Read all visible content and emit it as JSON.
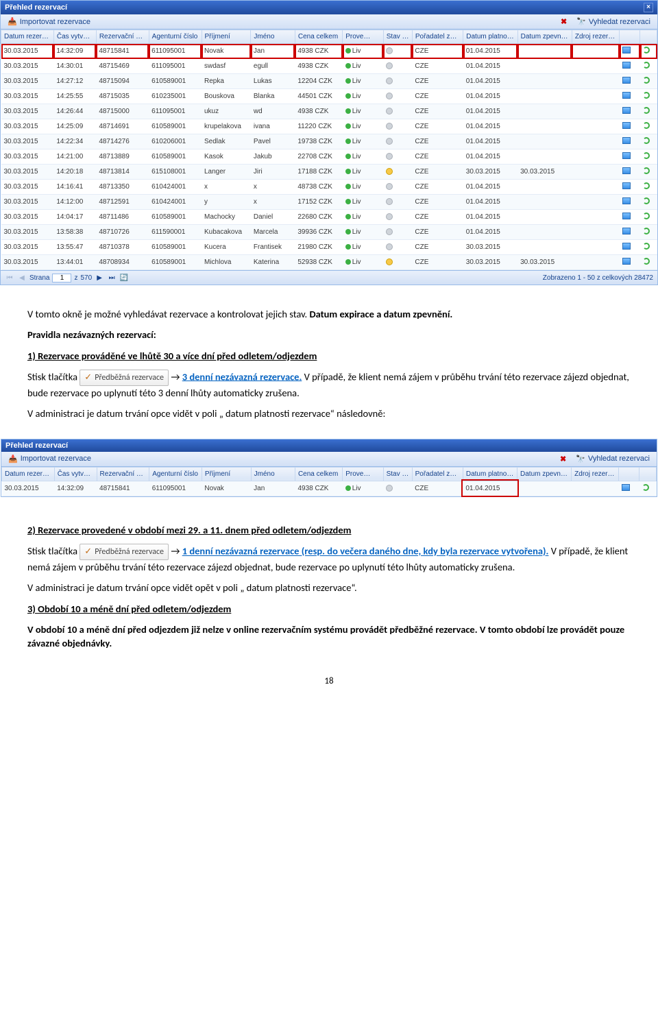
{
  "panel1": {
    "title": "Přehled rezervací",
    "toolbar": {
      "import": "Importovat rezervace",
      "search": "Vyhledat rezervaci"
    },
    "headers": [
      "Datum rezervace",
      "Čas vytvoření",
      "Rezervační číslo",
      "Agenturní číslo",
      "Příjmení",
      "Jméno",
      "Cena celkem",
      "Prove…",
      "Stav r…",
      "Pořadatel zájez…",
      "Datum platnosti…",
      "Datum zpevněn…",
      "Zdroj rezervace"
    ],
    "rows": [
      {
        "d": "30.03.2015",
        "t": "14:32:09",
        "r": "48715841",
        "a": "611095001",
        "s": "Novak",
        "f": "Jan",
        "c": "4938 CZK",
        "liv": "Liv",
        "stav": "grey",
        "cz": "CZE",
        "p": "01.04.2015",
        "z": "",
        "sel": true
      },
      {
        "d": "30.03.2015",
        "t": "14:30:01",
        "r": "48715469",
        "a": "611095001",
        "s": "swdasf",
        "f": "egull",
        "c": "4938 CZK",
        "liv": "Liv",
        "stav": "grey",
        "cz": "CZE",
        "p": "01.04.2015",
        "z": ""
      },
      {
        "d": "30.03.2015",
        "t": "14:27:12",
        "r": "48715094",
        "a": "610589001",
        "s": "Repka",
        "f": "Lukas",
        "c": "12204 CZK",
        "liv": "Liv",
        "stav": "grey",
        "cz": "CZE",
        "p": "01.04.2015",
        "z": ""
      },
      {
        "d": "30.03.2015",
        "t": "14:25:55",
        "r": "48715035",
        "a": "610235001",
        "s": "Bouskova",
        "f": "Blanka",
        "c": "44501 CZK",
        "liv": "Liv",
        "stav": "grey",
        "cz": "CZE",
        "p": "01.04.2015",
        "z": ""
      },
      {
        "d": "30.03.2015",
        "t": "14:26:44",
        "r": "48715000",
        "a": "611095001",
        "s": "ukuz",
        "f": "wd",
        "c": "4938 CZK",
        "liv": "Liv",
        "stav": "grey",
        "cz": "CZE",
        "p": "01.04.2015",
        "z": ""
      },
      {
        "d": "30.03.2015",
        "t": "14:25:09",
        "r": "48714691",
        "a": "610589001",
        "s": "krupelakova",
        "f": "ivana",
        "c": "11220 CZK",
        "liv": "Liv",
        "stav": "grey",
        "cz": "CZE",
        "p": "01.04.2015",
        "z": ""
      },
      {
        "d": "30.03.2015",
        "t": "14:22:34",
        "r": "48714276",
        "a": "610206001",
        "s": "Sedlak",
        "f": "Pavel",
        "c": "19738 CZK",
        "liv": "Liv",
        "stav": "grey",
        "cz": "CZE",
        "p": "01.04.2015",
        "z": ""
      },
      {
        "d": "30.03.2015",
        "t": "14:21:00",
        "r": "48713889",
        "a": "610589001",
        "s": "Kasok",
        "f": "Jakub",
        "c": "22708 CZK",
        "liv": "Liv",
        "stav": "grey",
        "cz": "CZE",
        "p": "01.04.2015",
        "z": ""
      },
      {
        "d": "30.03.2015",
        "t": "14:20:18",
        "r": "48713814",
        "a": "615108001",
        "s": "Langer",
        "f": "Jiri",
        "c": "17188 CZK",
        "liv": "Liv",
        "stav": "yellow",
        "cz": "CZE",
        "p": "30.03.2015",
        "z": "30.03.2015"
      },
      {
        "d": "30.03.2015",
        "t": "14:16:41",
        "r": "48713350",
        "a": "610424001",
        "s": "x",
        "f": "x",
        "c": "48738 CZK",
        "liv": "Liv",
        "stav": "grey",
        "cz": "CZE",
        "p": "01.04.2015",
        "z": ""
      },
      {
        "d": "30.03.2015",
        "t": "14:12:00",
        "r": "48712591",
        "a": "610424001",
        "s": "y",
        "f": "x",
        "c": "17152 CZK",
        "liv": "Liv",
        "stav": "grey",
        "cz": "CZE",
        "p": "01.04.2015",
        "z": ""
      },
      {
        "d": "30.03.2015",
        "t": "14:04:17",
        "r": "48711486",
        "a": "610589001",
        "s": "Machocky",
        "f": "Daniel",
        "c": "22680 CZK",
        "liv": "Liv",
        "stav": "grey",
        "cz": "CZE",
        "p": "01.04.2015",
        "z": ""
      },
      {
        "d": "30.03.2015",
        "t": "13:58:38",
        "r": "48710726",
        "a": "611590001",
        "s": "Kubacakova",
        "f": "Marcela",
        "c": "39936 CZK",
        "liv": "Liv",
        "stav": "grey",
        "cz": "CZE",
        "p": "01.04.2015",
        "z": ""
      },
      {
        "d": "30.03.2015",
        "t": "13:55:47",
        "r": "48710378",
        "a": "610589001",
        "s": "Kucera",
        "f": "Frantisek",
        "c": "21980 CZK",
        "liv": "Liv",
        "stav": "grey",
        "cz": "CZE",
        "p": "30.03.2015",
        "z": ""
      },
      {
        "d": "30.03.2015",
        "t": "13:44:01",
        "r": "48708934",
        "a": "610589001",
        "s": "Michlova",
        "f": "Katerina",
        "c": "52938 CZK",
        "liv": "Liv",
        "stav": "yellow",
        "cz": "CZE",
        "p": "30.03.2015",
        "z": "30.03.2015"
      }
    ],
    "pager": {
      "page_label": "Strana",
      "page": "1",
      "of_label": "z",
      "of": "570",
      "showing": "Zobrazeno 1 - 50 z celkových 28472"
    }
  },
  "panel2": {
    "title": "Přehled rezervací",
    "toolbar": {
      "import": "Importovat rezervace",
      "search": "Vyhledat rezervaci"
    },
    "headers": [
      "Datum rezervace",
      "Čas vytvoření",
      "Rezervační číslo",
      "Agenturní číslo",
      "Příjmení",
      "Jméno",
      "Cena celkem",
      "Prove…",
      "Stav r…",
      "Pořadatel zájez…",
      "Datum platnosti…",
      "Datum zpevněn…",
      "Zdroj rezervace"
    ],
    "row": {
      "d": "30.03.2015",
      "t": "14:32:09",
      "r": "48715841",
      "a": "611095001",
      "s": "Novak",
      "f": "Jan",
      "c": "4938 CZK",
      "liv": "Liv",
      "cz": "CZE",
      "p": "01.04.2015"
    }
  },
  "doc": {
    "p1a": "V tomto okně je možné vyhledávat rezervace a kontrolovat jejich stav. ",
    "p1b": "Datum expirace a datum zpevnění.",
    "p2": "Pravidla nezávazných rezervací:",
    "p3": "1) Rezervace prováděné ve lhůtě 30 a více dní před odletem/odjezdem",
    "btn": "Předběžná rezervace",
    "p4a": "Stisk tlačítka ",
    "p4b": " → ",
    "p4_link": "3 denní nezávazná rezervace.",
    "p4c": " V případě, že klient nemá zájem v průběhu trvání této rezervace zájezd objednat, bude rezervace po uplynutí této 3 denní lhůty automaticky zrušena.",
    "p5": "V administraci je datum trvání opce vidět v poli „ datum platnosti rezervace“ následovně:",
    "p6": "2) Rezervace provedené v období  mezi 29. a 11. dnem před odletem/odjezdem",
    "p7a": "Stisk tlačítka ",
    "p7b": " → ",
    "p7_link": "1 denní nezávazná rezervace (resp. do večera daného dne, kdy byla rezervace vytvořena).",
    "p7c": " V případě, že klient nemá zájem v průběhu trvání této rezervace zájezd objednat, bude rezervace po uplynutí této lhůty automaticky zrušena.",
    "p8": "V administraci je datum trvání opce vidět opět v poli „ datum platnosti rezervace“.",
    "p9": "3) Období 10 a méně dní před odletem/odjezdem",
    "p10": "V období 10 a méně dní před odjezdem již nelze v online rezervačním systému provádět předběžné rezervace. V tomto období lze provádět pouze závazné objednávky.",
    "page_num": "18"
  }
}
